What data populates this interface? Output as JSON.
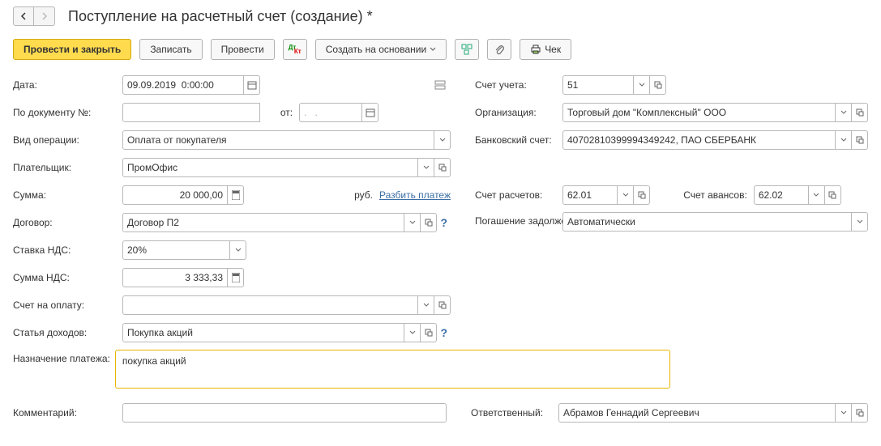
{
  "title": "Поступление на расчетный счет (создание) *",
  "toolbar": {
    "post_close": "Провести и закрыть",
    "record": "Записать",
    "post": "Провести",
    "create_from": "Создать на основании",
    "check": "Чек"
  },
  "labels": {
    "date": "Дата:",
    "doc_no": "По документу №:",
    "from": "от:",
    "op_type": "Вид операции:",
    "payer": "Плательщик:",
    "amount": "Сумма:",
    "currency": "руб.",
    "split": "Разбить платеж",
    "contract": "Договор:",
    "vat_rate": "Ставка НДС:",
    "vat_amount": "Сумма НДС:",
    "invoice": "Счет на оплату:",
    "income_item": "Статья доходов:",
    "purpose": "Назначение платежа:",
    "comment": "Комментарий:",
    "account": "Счет учета:",
    "org": "Организация:",
    "bank_acct": "Банковский счет:",
    "settle_acct": "Счет расчетов:",
    "advance_acct": "Счет авансов:",
    "debt_repay": "Погашение задолженности:",
    "responsible": "Ответственный:"
  },
  "values": {
    "date": "09.09.2019  0:00:00",
    "doc_no": "",
    "doc_from": ".   .",
    "op_type": "Оплата от покупателя",
    "payer": "ПромОфис",
    "amount": "20 000,00",
    "contract": "Договор П2",
    "vat_rate": "20%",
    "vat_amount": "3 333,33",
    "invoice": "",
    "income_item": "Покупка акций",
    "purpose": "покупка акций",
    "comment": "",
    "account": "51",
    "org": "Торговый дом \"Комплексный\" ООО",
    "bank_acct": "40702810399994349242, ПАО СБЕРБАНК",
    "settle_acct": "62.01",
    "advance_acct": "62.02",
    "debt_repay": "Автоматически",
    "responsible": "Абрамов Геннадий Сергеевич"
  }
}
